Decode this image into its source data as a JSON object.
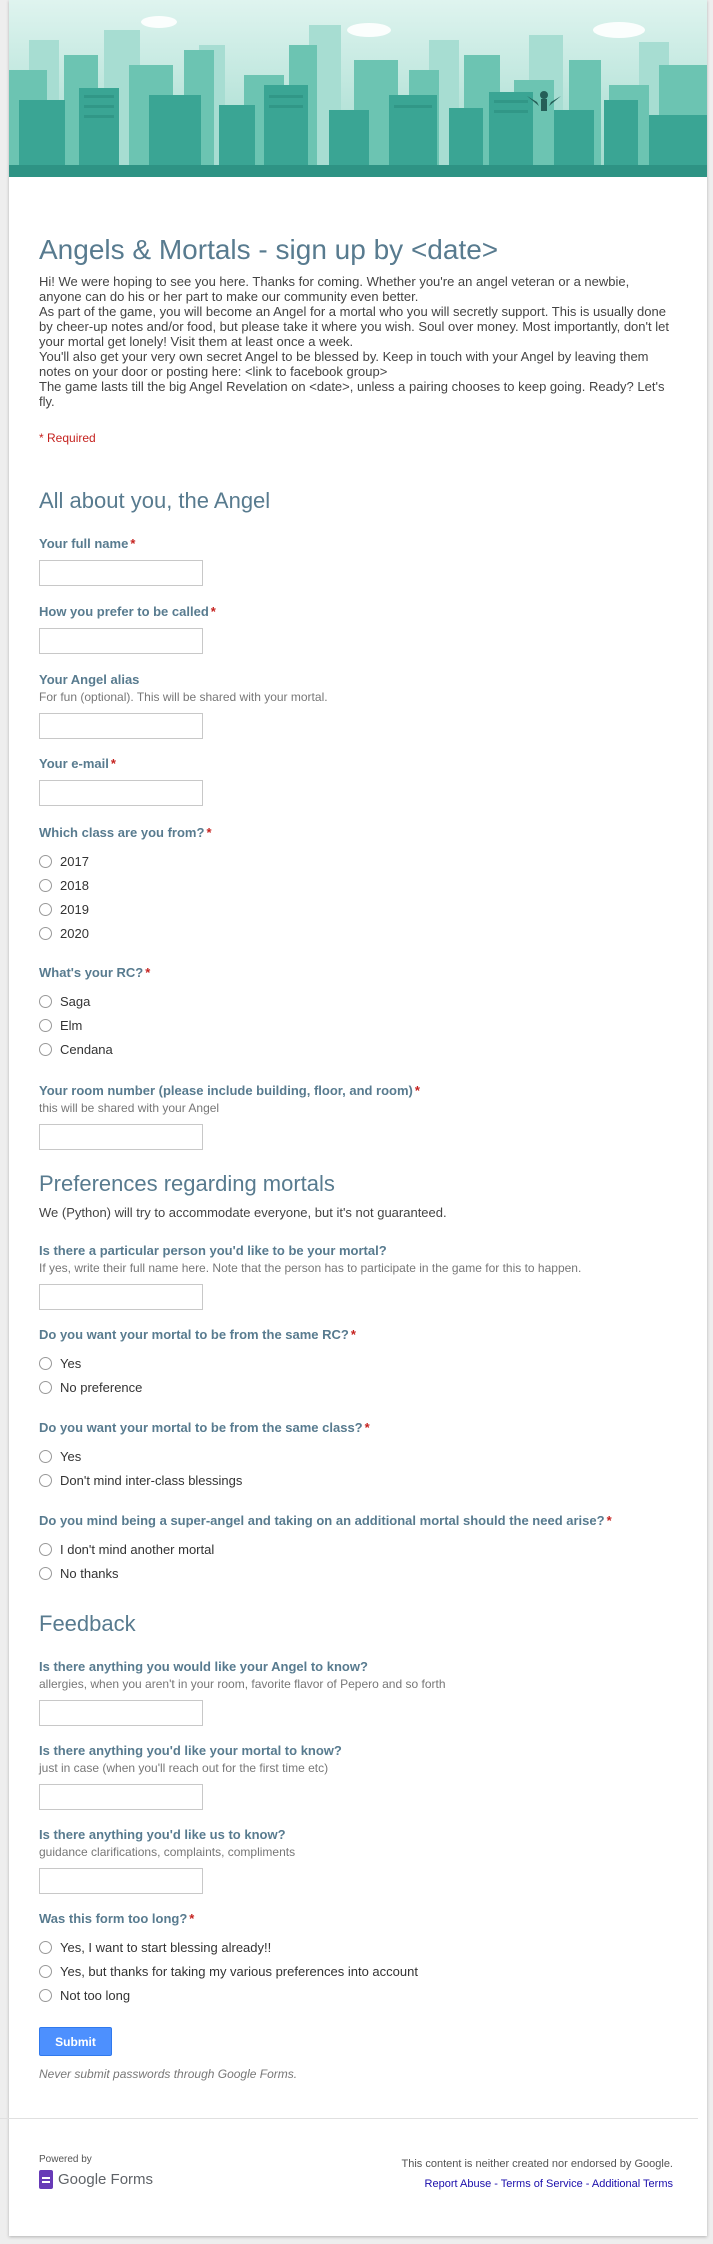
{
  "colors": {
    "accent": "#587b8f",
    "required": "#c5221f",
    "submit": "#4d90fe",
    "header_teal": "#3aa594"
  },
  "form": {
    "title": "Angels & Mortals - sign up by <date>",
    "description": [
      "Hi! We were hoping to see you here. Thanks for coming. Whether you're an angel veteran or a newbie, anyone can do his or her part to make our community even better.",
      "As part of the game, you will become an Angel for a mortal who you will secretly support. This is usually done by cheer-up notes and/or food, but please take it where you wish. Soul over money. Most importantly, don't let your mortal get lonely! Visit them at least once a week.",
      "You'll also get your very own secret Angel to be blessed by. Keep in touch with your Angel by leaving them notes on your door or posting here: <link to facebook group>",
      "The game lasts till the big Angel Revelation on <date>, unless a pairing chooses to keep going. Ready? Let's fly."
    ],
    "required_note": "* Required"
  },
  "sections": [
    {
      "title": "All about you, the Angel"
    },
    {
      "title": "Preferences regarding mortals",
      "description": "We (Python) will try to accommodate everyone, but it's not guaranteed."
    },
    {
      "title": "Feedback"
    }
  ],
  "questions": {
    "full_name": {
      "label": "Your full name",
      "star": "*"
    },
    "called": {
      "label": "How you prefer to be called",
      "star": "*"
    },
    "alias": {
      "label": "Your Angel alias",
      "help": "For fun (optional). This will be shared with your mortal."
    },
    "email": {
      "label": "Your e-mail",
      "star": "*"
    },
    "class": {
      "label": "Which class are you from?",
      "star": "*",
      "options": [
        "2017",
        "2018",
        "2019",
        "2020"
      ]
    },
    "rc": {
      "label": "What's your RC?",
      "star": "*",
      "options": [
        "Saga",
        "Elm",
        "Cendana"
      ]
    },
    "room": {
      "label": "Your room number (please include building, floor, and room)",
      "star": "*",
      "help": "this will be shared with your Angel"
    },
    "particular": {
      "label": "Is there a particular person you'd like to be your mortal?",
      "help": "If yes, write their full name here. Note that the person has to participate in the game for this to happen."
    },
    "same_rc": {
      "label": "Do you want your mortal to be from the same RC?",
      "star": "*",
      "options": [
        "Yes",
        "No preference"
      ]
    },
    "same_class": {
      "label": "Do you want your mortal to be from the same class?",
      "star": "*",
      "options": [
        "Yes",
        "Don't mind inter-class blessings"
      ]
    },
    "super_angel": {
      "label": "Do you mind being a super-angel and taking on an additional mortal should the need arise?",
      "star": "*",
      "options": [
        "I don't mind another mortal",
        "No thanks"
      ]
    },
    "angel_know": {
      "label": "Is there anything you would like your Angel to know?",
      "help": "allergies, when you aren't in your room, favorite flavor of Pepero and so forth"
    },
    "mortal_know": {
      "label": "Is there anything you'd like your mortal to know?",
      "help": "just in case (when you'll reach out for the first time etc)"
    },
    "us_know": {
      "label": "Is there anything you'd like us to know?",
      "help": "guidance clarifications, complaints, compliments"
    },
    "too_long": {
      "label": "Was this form too long?",
      "star": "*",
      "options": [
        "Yes, I want to start blessing already!!",
        "Yes, but thanks for taking my various preferences into account",
        "Not too long"
      ]
    }
  },
  "submit": {
    "label": "Submit",
    "note": "Never submit passwords through Google Forms."
  },
  "footer": {
    "powered_by": "Powered by",
    "logo_text": "Google Forms",
    "disclaimer": "This content is neither created nor endorsed by Google.",
    "links": [
      "Report Abuse",
      "Terms of Service",
      "Additional Terms"
    ],
    "link_separator": " - "
  }
}
